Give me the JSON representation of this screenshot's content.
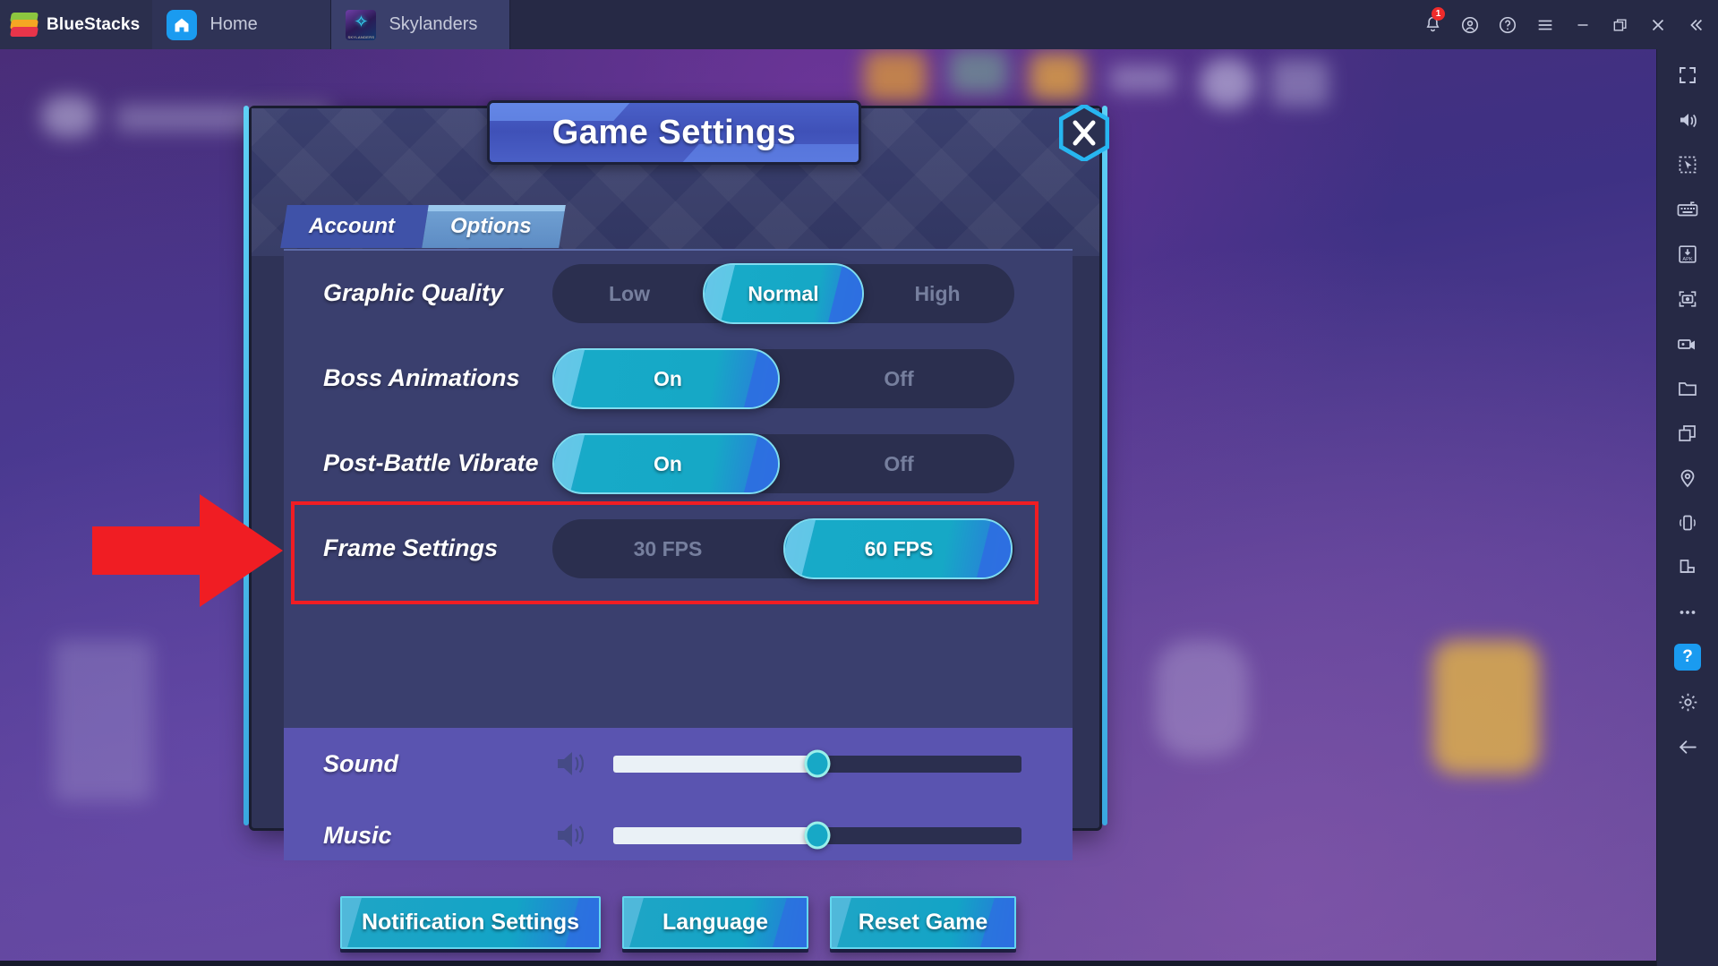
{
  "titlebar": {
    "brand": "BlueStacks",
    "tabs": [
      {
        "label": "Home",
        "icon": "home-icon"
      },
      {
        "label": "Skylanders",
        "icon": "game-thumbnail"
      }
    ],
    "controls": [
      {
        "name": "notifications-icon",
        "badge": "1"
      },
      {
        "name": "account-icon"
      },
      {
        "name": "help-icon"
      },
      {
        "name": "menu-icon"
      },
      {
        "name": "minimize-icon"
      },
      {
        "name": "restore-icon"
      },
      {
        "name": "close-icon"
      },
      {
        "name": "collapse-icon"
      }
    ],
    "notification_count": "1"
  },
  "dialog": {
    "title": "Game Settings",
    "close_label": "X",
    "tabs": [
      {
        "label": "Account",
        "active": false
      },
      {
        "label": "Options",
        "active": true
      }
    ],
    "settings": [
      {
        "label": "Graphic Quality",
        "type": "segment",
        "options": [
          "Low",
          "Normal",
          "High"
        ],
        "selected": "Normal",
        "selected_index": 1
      },
      {
        "label": "Boss Animations",
        "type": "segment",
        "options": [
          "On",
          "Off"
        ],
        "selected": "On",
        "selected_index": 0
      },
      {
        "label": "Post-Battle Vibrate",
        "type": "segment",
        "options": [
          "On",
          "Off"
        ],
        "selected": "On",
        "selected_index": 0
      },
      {
        "label": "Frame Settings",
        "type": "segment",
        "options": [
          "30 FPS",
          "60 FPS"
        ],
        "selected": "60 FPS",
        "selected_index": 1,
        "highlighted": true
      }
    ],
    "sliders": [
      {
        "label": "Sound",
        "icon": "speaker-icon",
        "value_percent": 50
      },
      {
        "label": "Music",
        "icon": "speaker-icon",
        "value_percent": 50
      }
    ],
    "buttons": [
      {
        "label": "Notification Settings"
      },
      {
        "label": "Language"
      },
      {
        "label": "Reset Game"
      }
    ]
  },
  "annotation": {
    "arrow_color": "#f01d23",
    "highlight_color": "#f01d23",
    "target": "Frame Settings"
  },
  "sidebar": {
    "items": [
      {
        "name": "fullscreen-icon"
      },
      {
        "name": "volume-icon"
      },
      {
        "name": "cursor-select-icon"
      },
      {
        "name": "keyboard-controls-icon"
      },
      {
        "name": "install-apk-icon"
      },
      {
        "name": "screenshot-icon"
      },
      {
        "name": "record-icon"
      },
      {
        "name": "media-folder-icon"
      },
      {
        "name": "multi-instance-icon"
      },
      {
        "name": "location-icon"
      },
      {
        "name": "shake-icon"
      },
      {
        "name": "rotate-icon"
      },
      {
        "name": "more-icon"
      },
      {
        "name": "help-icon",
        "label": "?",
        "active": true
      },
      {
        "name": "settings-gear-icon"
      },
      {
        "name": "back-icon"
      }
    ]
  },
  "colors": {
    "accent_cyan": "#17a8c6",
    "accent_blue": "#2a72dd",
    "panel": "#3a3f6e",
    "dialog_bg": "#2f3357",
    "highlight_red": "#f01d23",
    "titlebar": "#262945"
  }
}
